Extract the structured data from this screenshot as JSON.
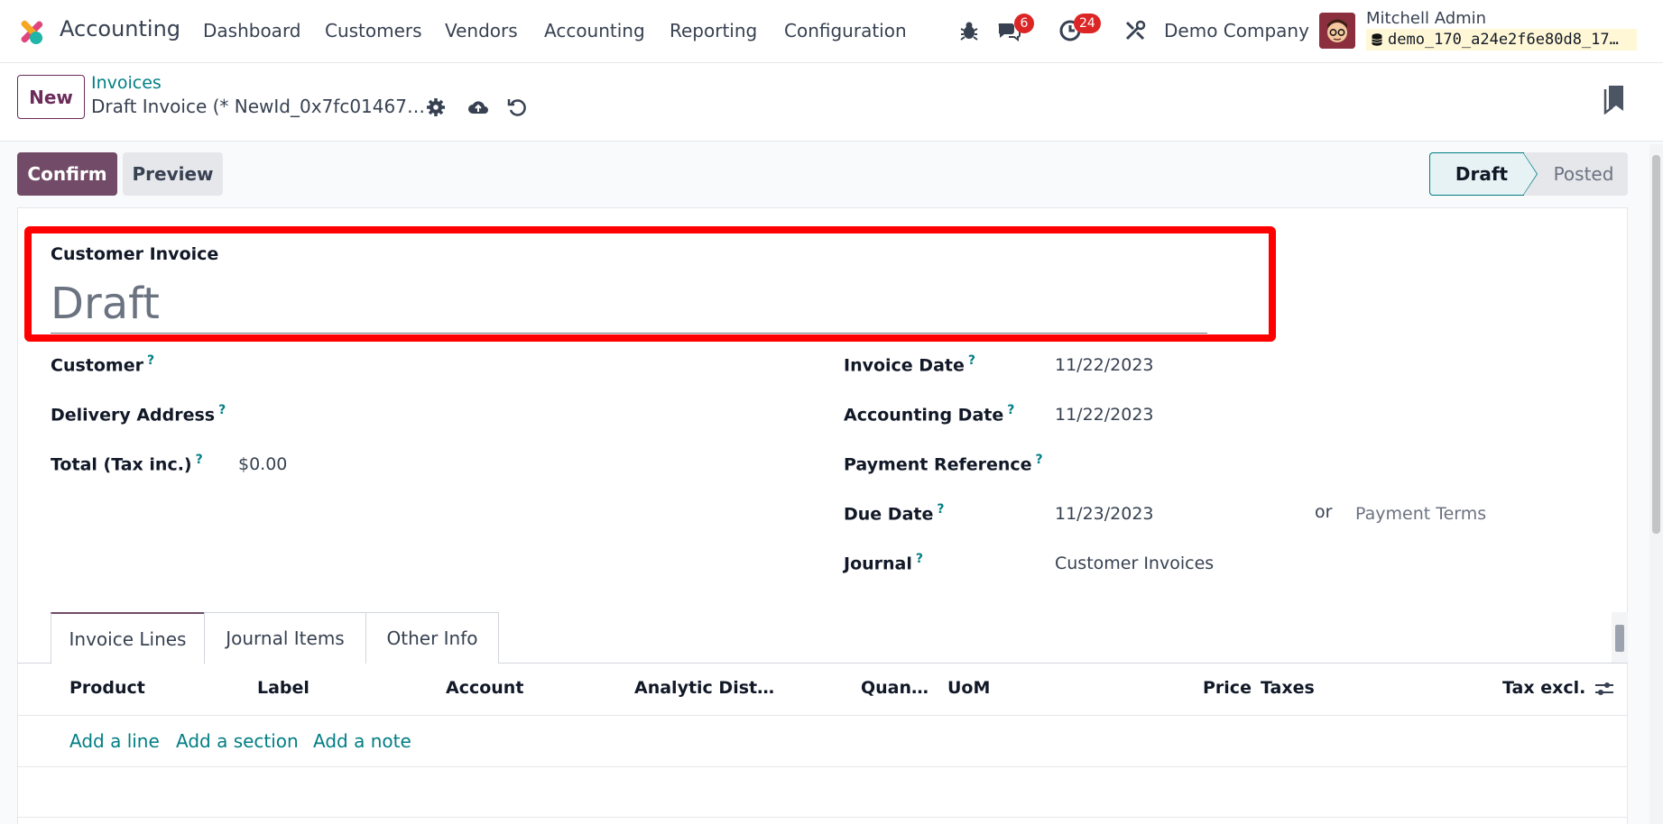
{
  "navbar": {
    "app_name": "Accounting",
    "menu": [
      "Dashboard",
      "Customers",
      "Vendors",
      "Accounting",
      "Reporting",
      "Configuration"
    ],
    "messages_badge": "6",
    "activities_badge": "24",
    "company": "Demo Company",
    "user_name": "Mitchell Admin",
    "database": "demo_170_a24e2f6e80d8_17…"
  },
  "control_panel": {
    "new_label": "New",
    "breadcrumb_parent": "Invoices",
    "breadcrumb_current": "Draft Invoice (* NewId_0x7fc01467…"
  },
  "actions": {
    "confirm_label": "Confirm",
    "preview_label": "Preview"
  },
  "status": {
    "stages": [
      "Draft",
      "Posted"
    ],
    "current": "Draft"
  },
  "form": {
    "move_type": "Customer Invoice",
    "name": "Draft",
    "left_fields": [
      {
        "label": "Customer",
        "value": ""
      },
      {
        "label": "Delivery Address",
        "value": ""
      },
      {
        "label": "Total (Tax inc.)",
        "value": "$0.00"
      }
    ],
    "right_fields": [
      {
        "label": "Invoice Date",
        "value": "11/22/2023"
      },
      {
        "label": "Accounting Date",
        "value": "11/22/2023"
      },
      {
        "label": "Payment Reference",
        "value": ""
      },
      {
        "label": "Due Date",
        "value": "11/23/2023"
      },
      {
        "label": "Journal",
        "value": "Customer Invoices"
      }
    ],
    "due_date_or": "or",
    "payment_terms_placeholder": "Payment Terms",
    "help_mark": "?"
  },
  "tabs": [
    "Invoice Lines",
    "Journal Items",
    "Other Info"
  ],
  "table": {
    "columns": [
      "Product",
      "Label",
      "Account",
      "Analytic Dist…",
      "Quan…",
      "UoM",
      "Price",
      "Taxes",
      "Tax excl."
    ],
    "add_links": [
      "Add a line",
      "Add a section",
      "Add a note"
    ]
  }
}
